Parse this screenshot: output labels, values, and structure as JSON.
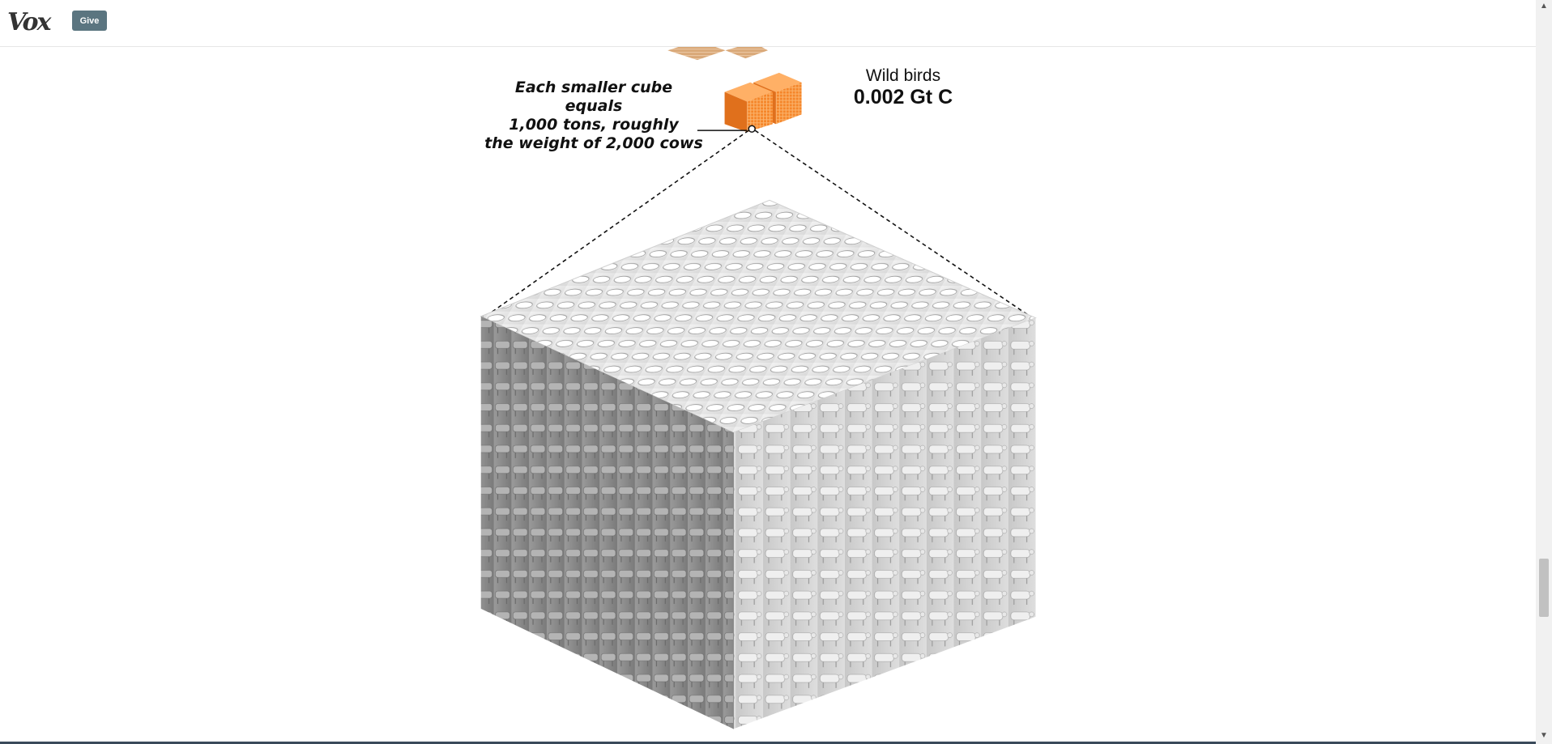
{
  "header": {
    "logo_text": "Vox",
    "give_label": "Give"
  },
  "graphic": {
    "caption_lines": [
      "Each smaller cube equals",
      "1,000 tons, roughly",
      "the weight of 2,000 cows"
    ],
    "category_name": "Wild birds",
    "category_value": "0.002 Gt C",
    "colors": {
      "small_cube": "#f5862a",
      "cow_cube": "#bdbdbd"
    }
  }
}
